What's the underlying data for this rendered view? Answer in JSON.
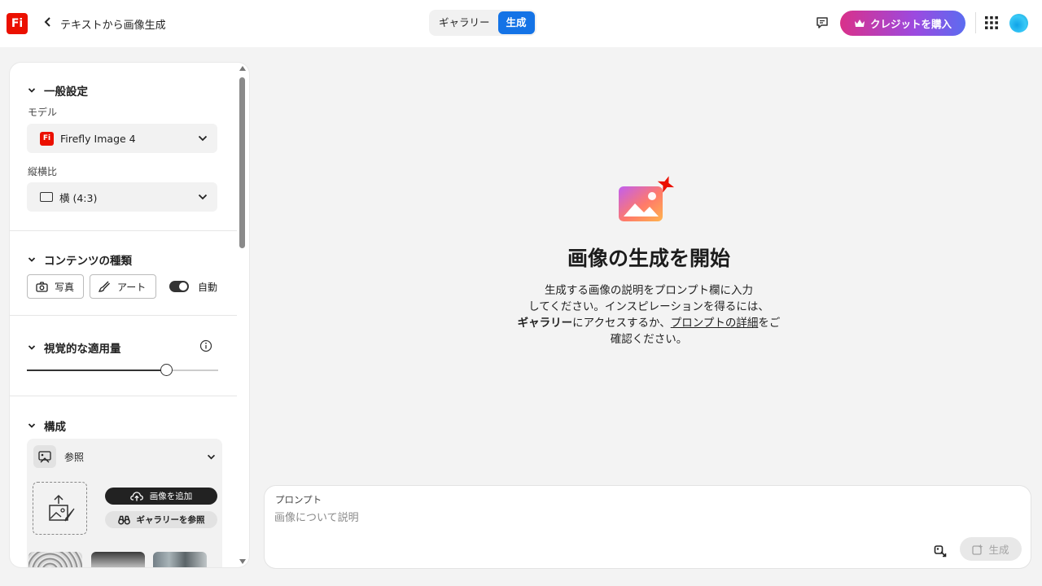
{
  "header": {
    "logo_text": "Fi",
    "title": "テキストから画像生成",
    "tabs": [
      {
        "label": "ギャラリー",
        "active": false
      },
      {
        "label": "生成",
        "active": true
      }
    ],
    "buy_credits_label": "クレジットを購入",
    "accent_color": "#1473e6",
    "logo_color": "#eb1000"
  },
  "settings": {
    "general": {
      "title": "一般設定",
      "model_label": "モデル",
      "model_value": "Firefly Image 4",
      "model_icon_text": "Fi",
      "aspect_label": "縦横比",
      "aspect_value": "横 (4:3)"
    },
    "content_type": {
      "title": "コンテンツの種類",
      "photo_label": "写真",
      "art_label": "アート",
      "auto_label": "自動",
      "auto_on": true
    },
    "visual_intensity": {
      "title": "視覚的な適用量",
      "level": 0.73
    },
    "composition": {
      "title": "構成",
      "reference_label": "参照",
      "add_image_label": "画像を追加",
      "browse_gallery_label": "ギャラリーを参照"
    }
  },
  "main": {
    "empty_title": "画像の生成を開始",
    "desc_line1": "生成する画像の説明をプロンプト欄に入力",
    "desc_line2": "してください。インスピレーションを得るには、",
    "desc_gallery": "ギャラリー",
    "desc_mid": "にアクセスするか、",
    "desc_prompt_link": "プロンプトの詳細",
    "desc_tail": "をご",
    "desc_line4": "確認ください。"
  },
  "prompt": {
    "label": "プロンプト",
    "placeholder": "画像について説明",
    "value": "",
    "generate_label": "生成"
  }
}
